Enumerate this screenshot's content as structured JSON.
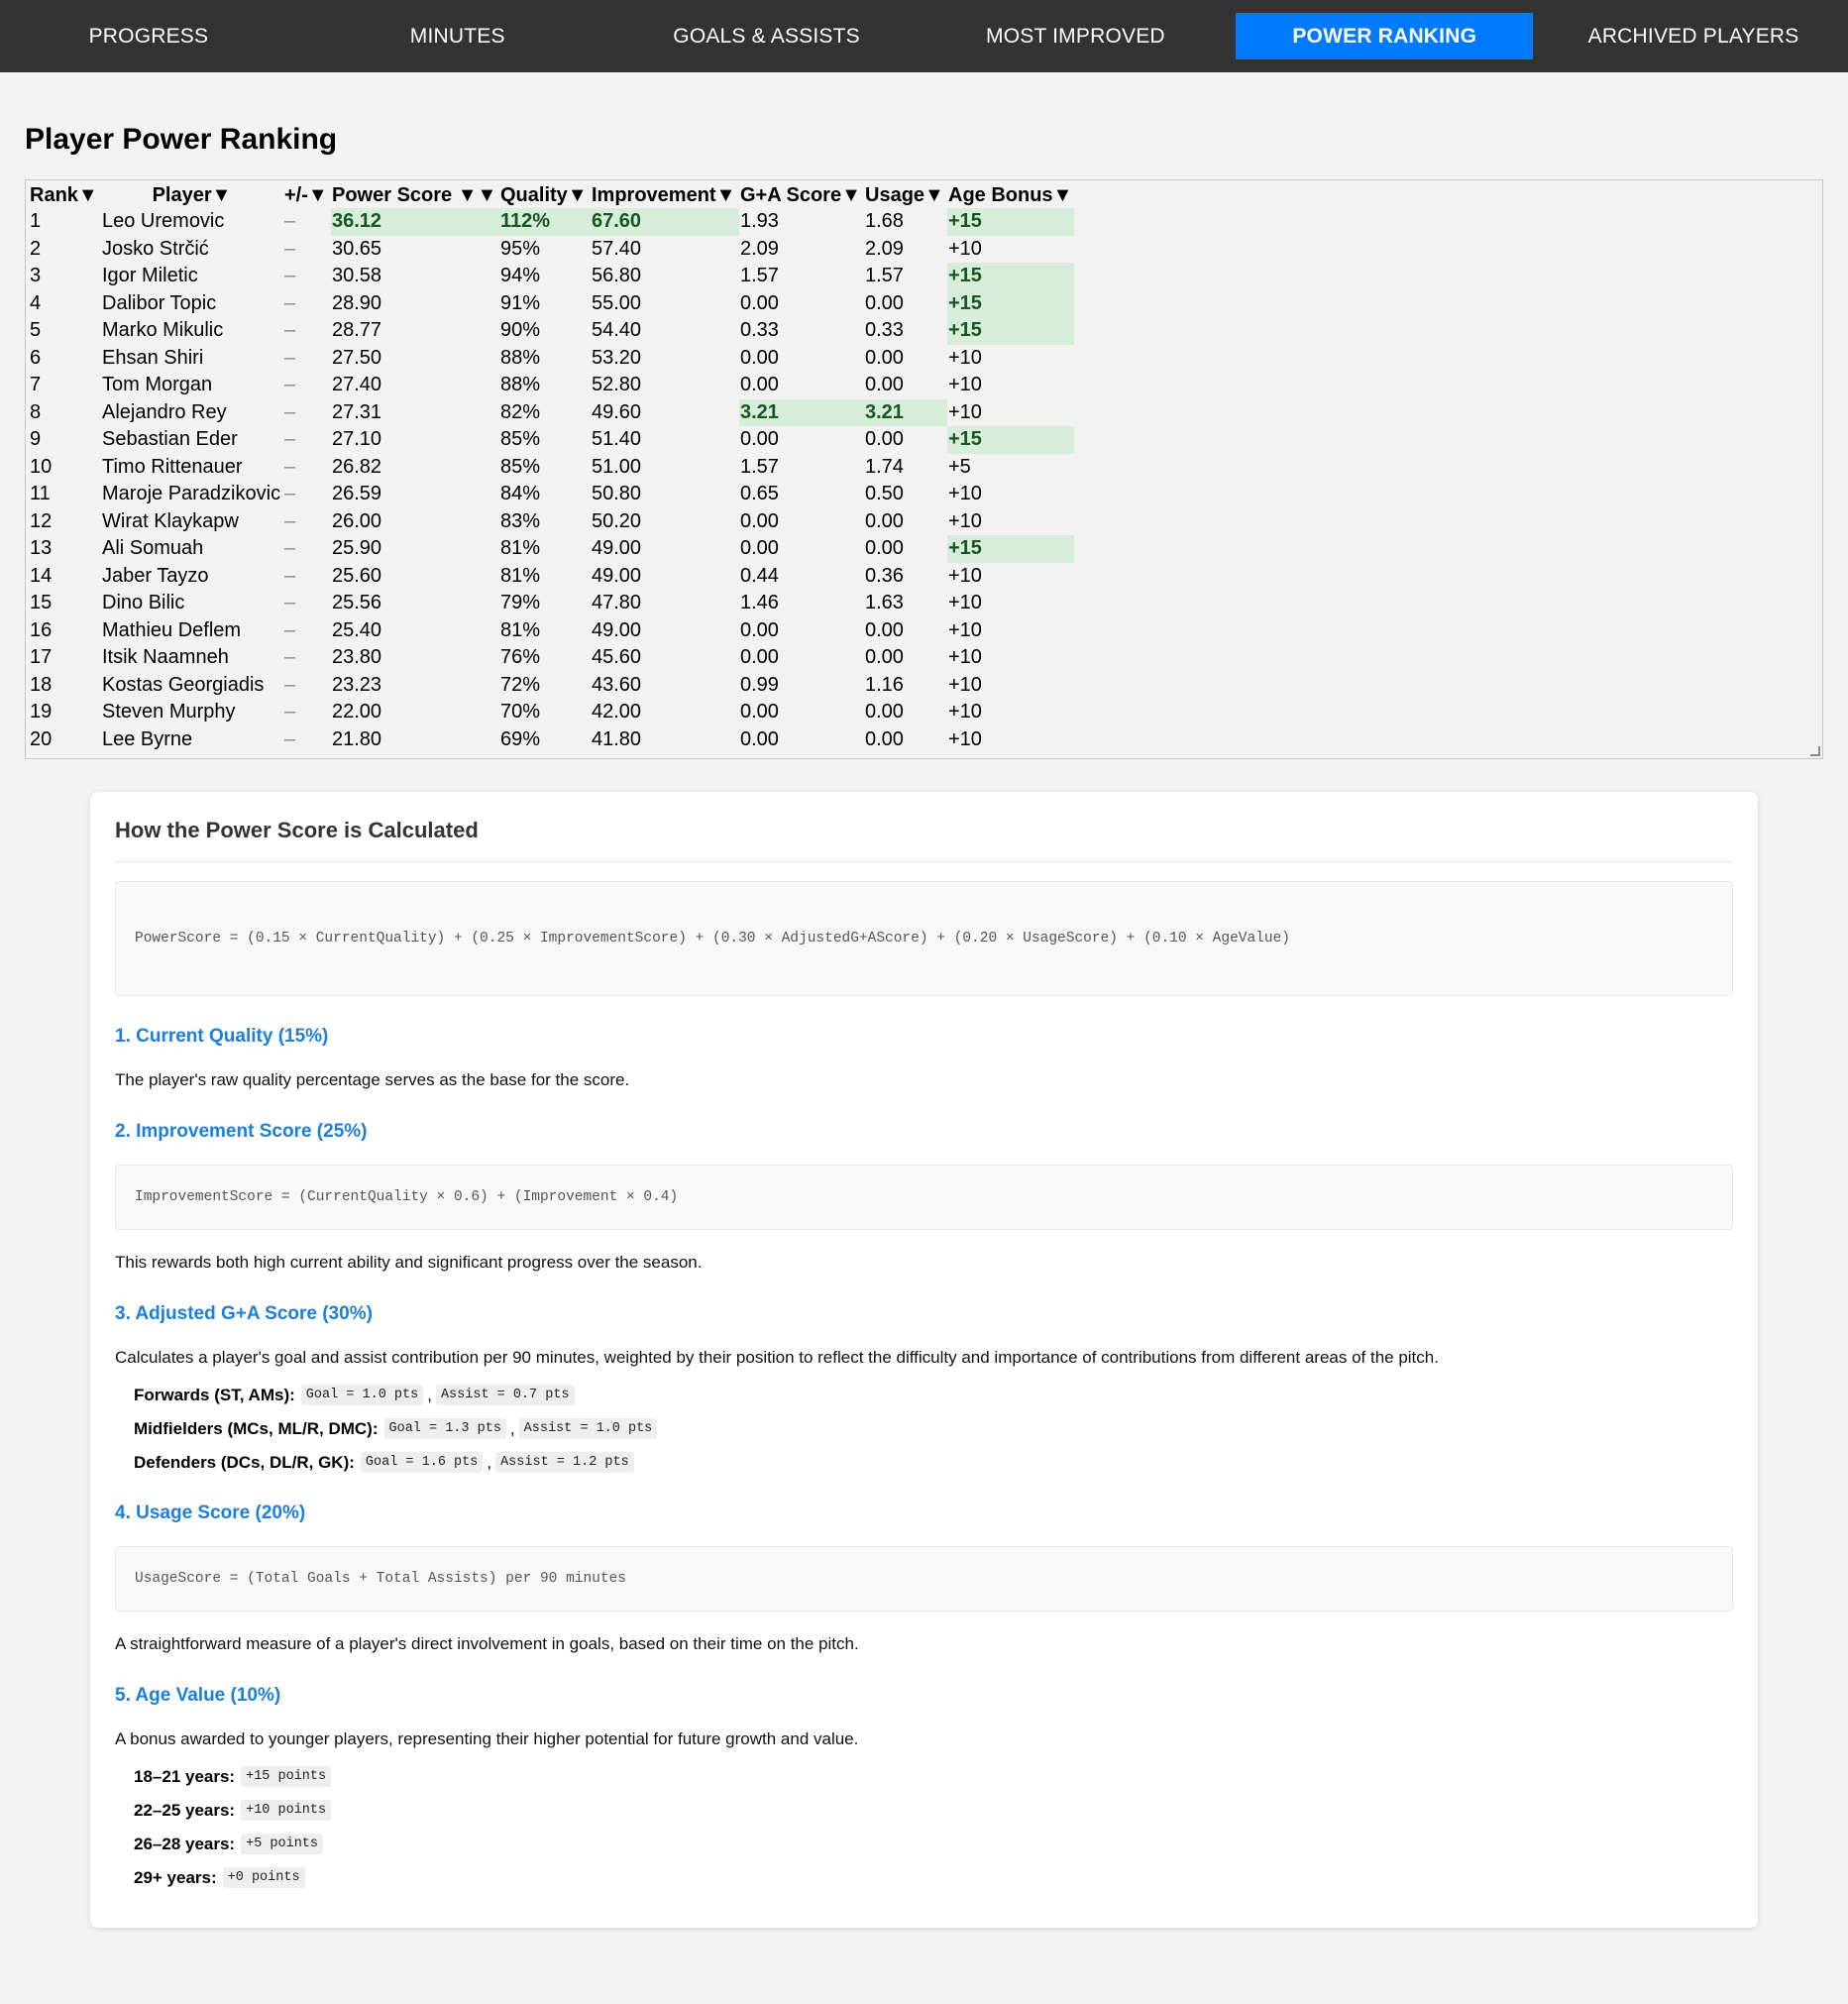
{
  "nav": {
    "items": [
      {
        "label": "PROGRESS",
        "active": false
      },
      {
        "label": "MINUTES",
        "active": false
      },
      {
        "label": "GOALS & ASSISTS",
        "active": false
      },
      {
        "label": "MOST IMPROVED",
        "active": false
      },
      {
        "label": "POWER RANKING",
        "active": true
      },
      {
        "label": "ARCHIVED PLAYERS",
        "active": false
      }
    ],
    "active_color": "#007bff",
    "bar_color": "#333333"
  },
  "page": {
    "title": "Player Power Ranking"
  },
  "table": {
    "headers": {
      "rank": "Rank▼",
      "player": "Player▼",
      "pm": "+/-▼",
      "power": "Power Score ▼▼",
      "quality": "Quality▼",
      "improvement": "Improvement▼",
      "ga": "G+A Score▼",
      "usage": "Usage▼",
      "age": "Age Bonus▼"
    },
    "highlight_color": "#d8edd9",
    "rows": [
      {
        "rank": "1",
        "player": "Leo Uremovic",
        "pm": "–",
        "power": "36.12",
        "quality": "112%",
        "improvement": "67.60",
        "ga": "1.93",
        "usage": "1.68",
        "age": "+15",
        "hl": [
          "power",
          "quality",
          "improvement",
          "age"
        ]
      },
      {
        "rank": "2",
        "player": "Josko Strčić",
        "pm": "–",
        "power": "30.65",
        "quality": "95%",
        "improvement": "57.40",
        "ga": "2.09",
        "usage": "2.09",
        "age": "+10",
        "hl": []
      },
      {
        "rank": "3",
        "player": "Igor Miletic",
        "pm": "–",
        "power": "30.58",
        "quality": "94%",
        "improvement": "56.80",
        "ga": "1.57",
        "usage": "1.57",
        "age": "+15",
        "hl": [
          "age"
        ]
      },
      {
        "rank": "4",
        "player": "Dalibor Topic",
        "pm": "–",
        "power": "28.90",
        "quality": "91%",
        "improvement": "55.00",
        "ga": "0.00",
        "usage": "0.00",
        "age": "+15",
        "hl": [
          "age"
        ]
      },
      {
        "rank": "5",
        "player": "Marko Mikulic",
        "pm": "–",
        "power": "28.77",
        "quality": "90%",
        "improvement": "54.40",
        "ga": "0.33",
        "usage": "0.33",
        "age": "+15",
        "hl": [
          "age"
        ]
      },
      {
        "rank": "6",
        "player": "Ehsan Shiri",
        "pm": "–",
        "power": "27.50",
        "quality": "88%",
        "improvement": "53.20",
        "ga": "0.00",
        "usage": "0.00",
        "age": "+10",
        "hl": []
      },
      {
        "rank": "7",
        "player": "Tom Morgan",
        "pm": "–",
        "power": "27.40",
        "quality": "88%",
        "improvement": "52.80",
        "ga": "0.00",
        "usage": "0.00",
        "age": "+10",
        "hl": []
      },
      {
        "rank": "8",
        "player": "Alejandro Rey",
        "pm": "–",
        "power": "27.31",
        "quality": "82%",
        "improvement": "49.60",
        "ga": "3.21",
        "usage": "3.21",
        "age": "+10",
        "hl": [
          "ga",
          "usage"
        ]
      },
      {
        "rank": "9",
        "player": "Sebastian Eder",
        "pm": "–",
        "power": "27.10",
        "quality": "85%",
        "improvement": "51.40",
        "ga": "0.00",
        "usage": "0.00",
        "age": "+15",
        "hl": [
          "age"
        ]
      },
      {
        "rank": "10",
        "player": "Timo Rittenauer",
        "pm": "–",
        "power": "26.82",
        "quality": "85%",
        "improvement": "51.00",
        "ga": "1.57",
        "usage": "1.74",
        "age": "+5",
        "hl": []
      },
      {
        "rank": "11",
        "player": "Maroje Paradzikovic",
        "pm": "–",
        "power": "26.59",
        "quality": "84%",
        "improvement": "50.80",
        "ga": "0.65",
        "usage": "0.50",
        "age": "+10",
        "hl": []
      },
      {
        "rank": "12",
        "player": "Wirat Klaykapw",
        "pm": "–",
        "power": "26.00",
        "quality": "83%",
        "improvement": "50.20",
        "ga": "0.00",
        "usage": "0.00",
        "age": "+10",
        "hl": []
      },
      {
        "rank": "13",
        "player": "Ali Somuah",
        "pm": "–",
        "power": "25.90",
        "quality": "81%",
        "improvement": "49.00",
        "ga": "0.00",
        "usage": "0.00",
        "age": "+15",
        "hl": [
          "age"
        ]
      },
      {
        "rank": "14",
        "player": "Jaber Tayzo",
        "pm": "–",
        "power": "25.60",
        "quality": "81%",
        "improvement": "49.00",
        "ga": "0.44",
        "usage": "0.36",
        "age": "+10",
        "hl": []
      },
      {
        "rank": "15",
        "player": "Dino Bilic",
        "pm": "–",
        "power": "25.56",
        "quality": "79%",
        "improvement": "47.80",
        "ga": "1.46",
        "usage": "1.63",
        "age": "+10",
        "hl": []
      },
      {
        "rank": "16",
        "player": "Mathieu Deflem",
        "pm": "–",
        "power": "25.40",
        "quality": "81%",
        "improvement": "49.00",
        "ga": "0.00",
        "usage": "0.00",
        "age": "+10",
        "hl": []
      },
      {
        "rank": "17",
        "player": "Itsik Naamneh",
        "pm": "–",
        "power": "23.80",
        "quality": "76%",
        "improvement": "45.60",
        "ga": "0.00",
        "usage": "0.00",
        "age": "+10",
        "hl": []
      },
      {
        "rank": "18",
        "player": "Kostas Georgiadis",
        "pm": "–",
        "power": "23.23",
        "quality": "72%",
        "improvement": "43.60",
        "ga": "0.99",
        "usage": "1.16",
        "age": "+10",
        "hl": []
      },
      {
        "rank": "19",
        "player": "Steven Murphy",
        "pm": "–",
        "power": "22.00",
        "quality": "70%",
        "improvement": "42.00",
        "ga": "0.00",
        "usage": "0.00",
        "age": "+10",
        "hl": []
      },
      {
        "rank": "20",
        "player": "Lee Byrne",
        "pm": "–",
        "power": "21.80",
        "quality": "69%",
        "improvement": "41.80",
        "ga": "0.00",
        "usage": "0.00",
        "age": "+10",
        "hl": []
      }
    ]
  },
  "explain": {
    "title": "How the Power Score is Calculated",
    "formula": "PowerScore = (0.15 × CurrentQuality) + (0.25 × ImprovementScore) + (0.30 × AdjustedG+AScore) + (0.20 × UsageScore) + (0.10 × AgeValue)",
    "s1_title": "1. Current Quality (15%)",
    "s1_text": "The player's raw quality percentage serves as the base for the score.",
    "s2_title": "2. Improvement Score (25%)",
    "s2_code": "ImprovementScore = (CurrentQuality × 0.6) + (Improvement × 0.4)",
    "s2_text": "This rewards both high current ability and significant progress over the season.",
    "s3_title": "3. Adjusted G+A Score (30%)",
    "s3_text": "Calculates a player's goal and assist contribution per 90 minutes, weighted by their position to reflect the difficulty and importance of contributions from different areas of the pitch.",
    "s3_rows": [
      {
        "label": "Forwards (ST, AMs):",
        "goal": "Goal = 1.0 pts",
        "assist": "Assist = 0.7 pts"
      },
      {
        "label": "Midfielders (MCs, ML/R, DMC):",
        "goal": "Goal = 1.3 pts",
        "assist": "Assist = 1.0 pts"
      },
      {
        "label": "Defenders (DCs, DL/R, GK):",
        "goal": "Goal = 1.6 pts",
        "assist": "Assist = 1.2 pts"
      }
    ],
    "s4_title": "4. Usage Score (20%)",
    "s4_code": "UsageScore = (Total Goals + Total Assists) per 90 minutes",
    "s4_text": "A straightforward measure of a player's direct involvement in goals, based on their time on the pitch.",
    "s5_title": "5. Age Value (10%)",
    "s5_text": "A bonus awarded to younger players, representing their higher potential for future growth and value.",
    "s5_rows": [
      {
        "label": "18–21 years:",
        "value": "+15 points"
      },
      {
        "label": "22–25 years:",
        "value": "+10 points"
      },
      {
        "label": "26–28 years:",
        "value": "+5 points"
      },
      {
        "label": "29+ years:",
        "value": "+0 points"
      }
    ]
  }
}
